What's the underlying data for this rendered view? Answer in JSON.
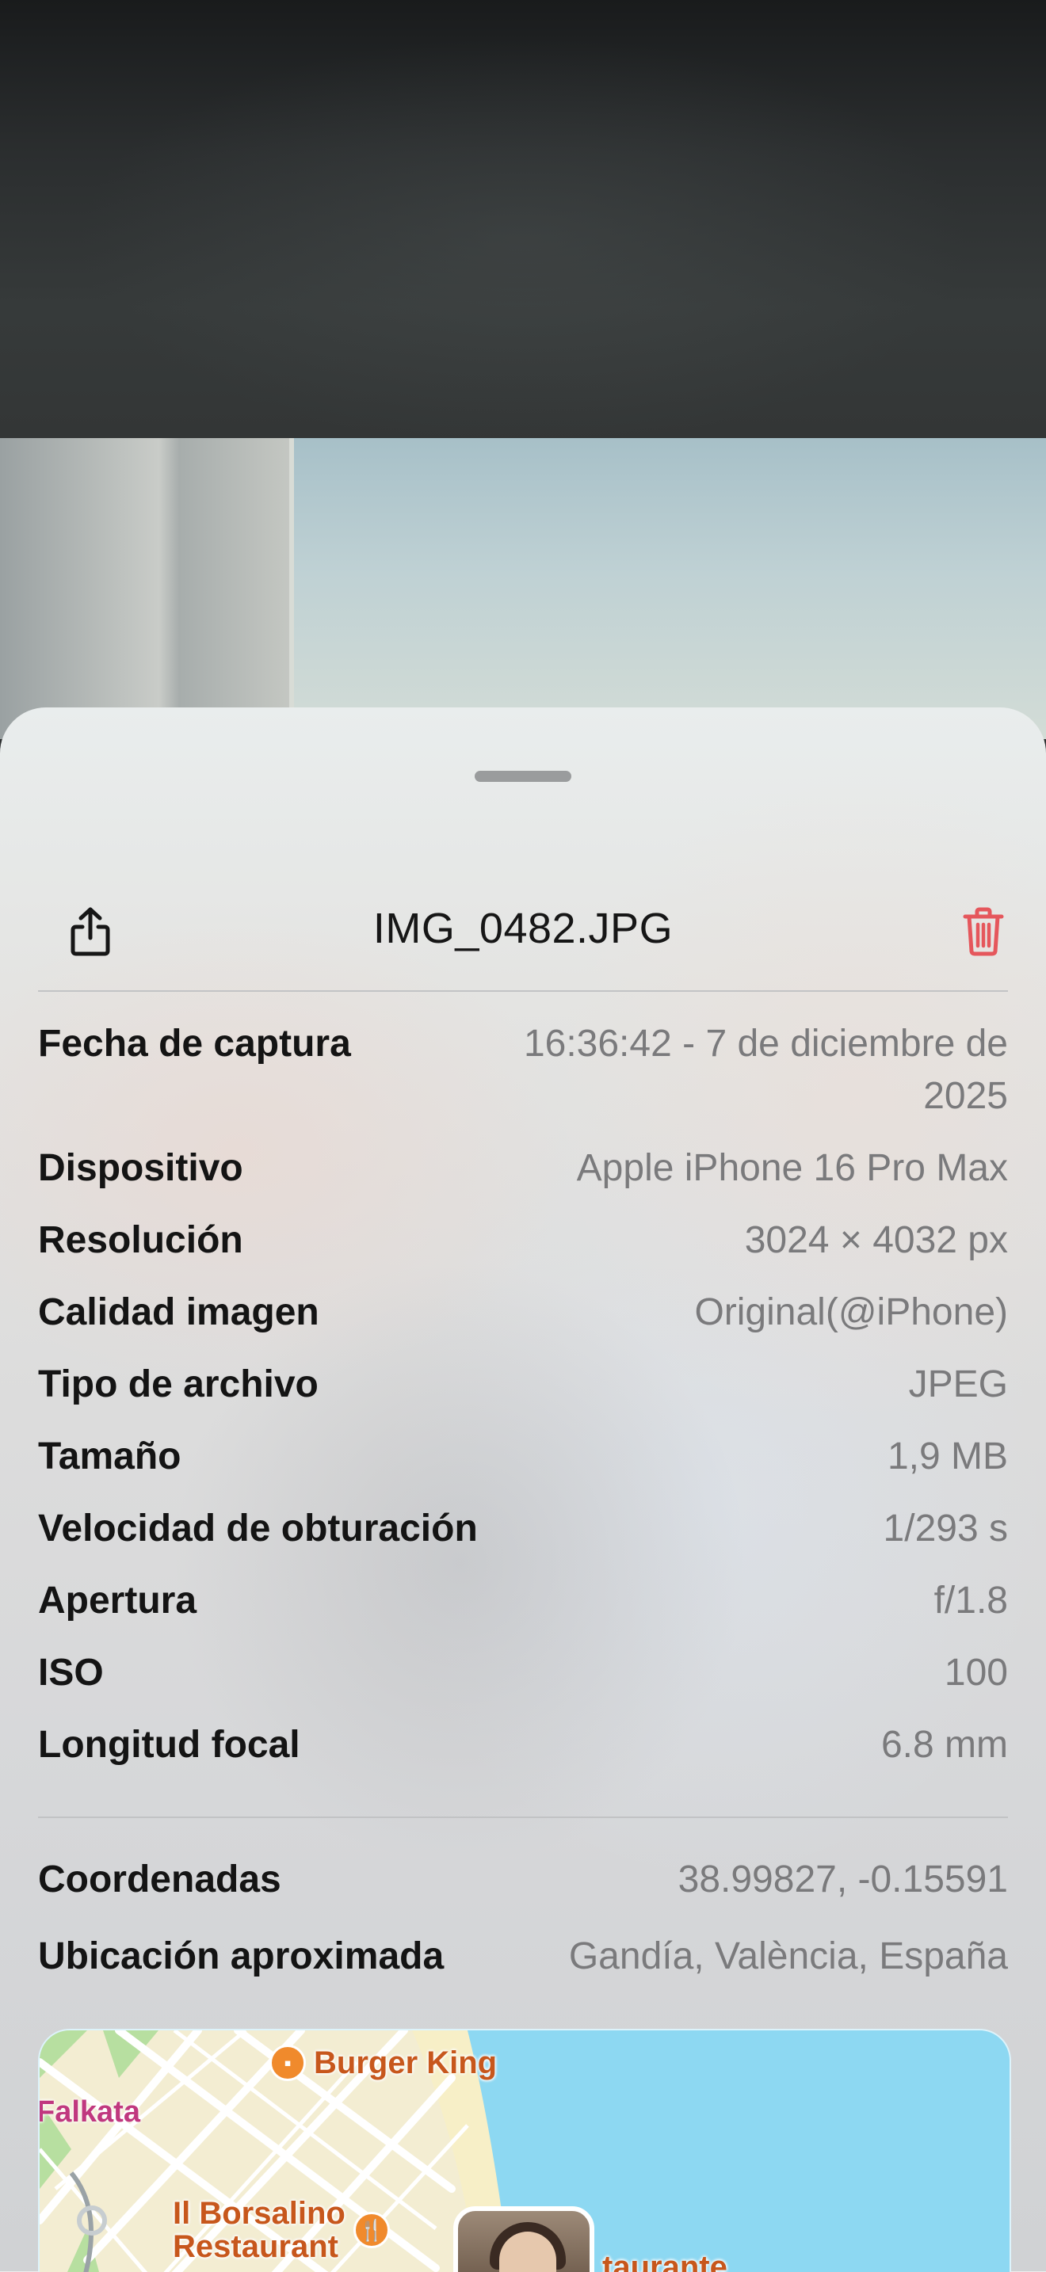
{
  "file": {
    "title": "IMG_0482.JPG"
  },
  "header": {
    "share_icon": "share-icon",
    "trash_icon": "trash-icon",
    "trash_color": "#e5575c"
  },
  "details": [
    {
      "label": "Fecha de captura",
      "value": "16:36:42 - 7 de diciembre de 2025"
    },
    {
      "label": "Dispositivo",
      "value": "Apple iPhone 16 Pro Max"
    },
    {
      "label": "Resolución",
      "value": "3024 × 4032 px"
    },
    {
      "label": "Calidad imagen",
      "value": "Original(@iPhone)"
    },
    {
      "label": "Tipo de archivo",
      "value": "JPEG"
    },
    {
      "label": "Tamaño",
      "value": "1,9 MB"
    },
    {
      "label": "Velocidad de obturación",
      "value": "1/293 s"
    },
    {
      "label": "Apertura",
      "value": "f/1.8"
    },
    {
      "label": "ISO",
      "value": "100"
    },
    {
      "label": "Longitud focal",
      "value": "6.8 mm"
    }
  ],
  "location": [
    {
      "label": "Coordenadas",
      "value": "38.99827, -0.15591"
    },
    {
      "label": "Ubicación aproximada",
      "value": "Gandía, València, España"
    }
  ],
  "map": {
    "poi_burger_king": "Burger King",
    "poi_borsalino_line1": "Il Borsalino",
    "poi_borsalino_line2": "Restaurant",
    "place_falkata": "Falkata",
    "partial_label": "taurante",
    "sea_color": "#8dd8f2"
  }
}
